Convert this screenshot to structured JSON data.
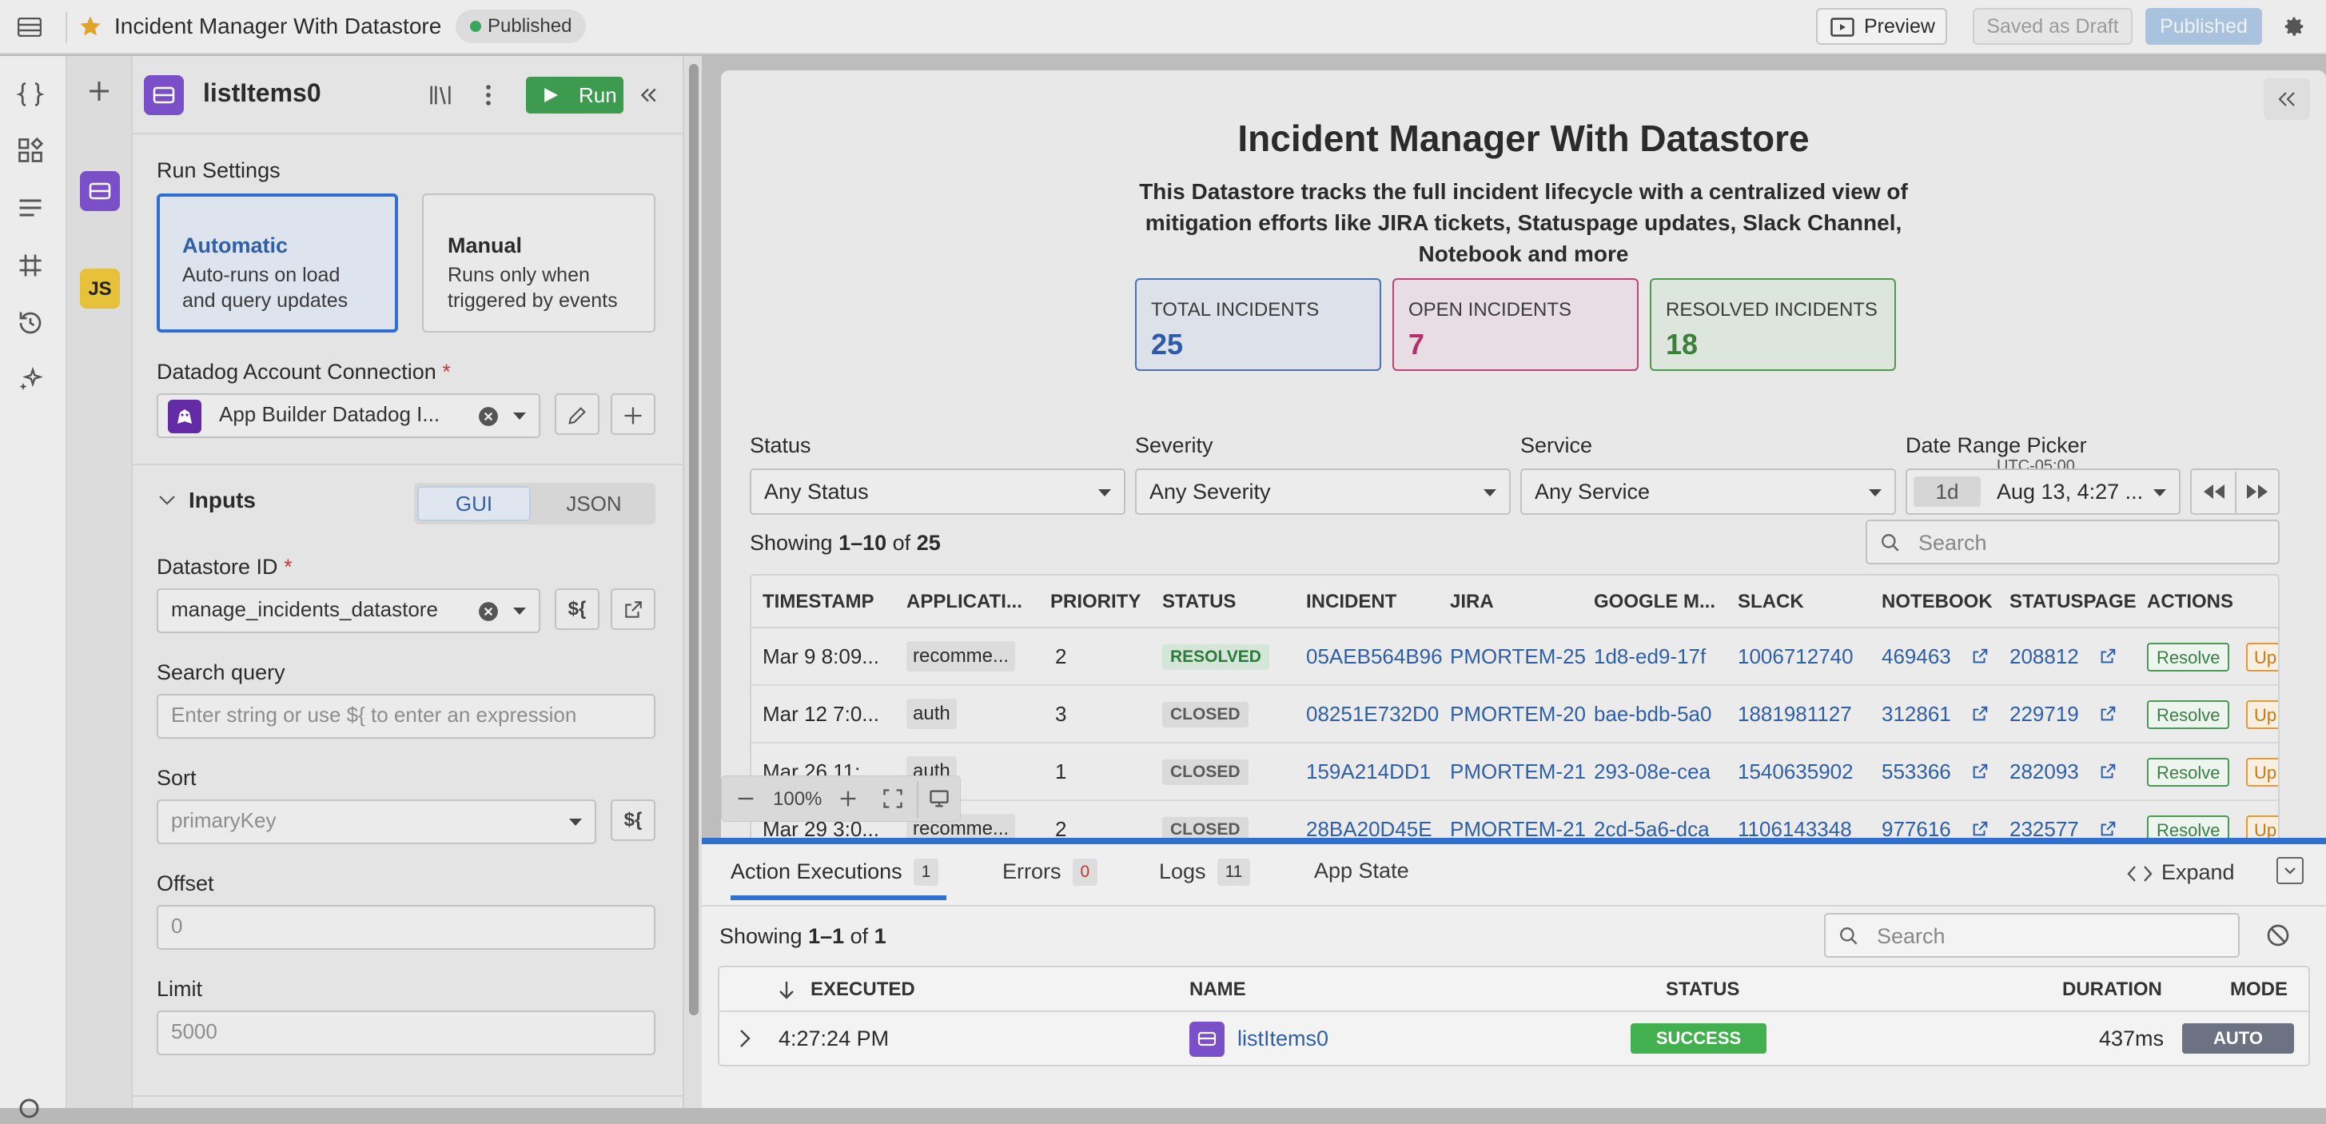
{
  "topbar": {
    "title": "Incident Manager With Datastore",
    "status_badge": "Published",
    "preview_label": "Preview",
    "draft_label": "Saved as Draft",
    "publish_label": "Published"
  },
  "rail": {
    "icons": [
      "layout-icon",
      "braces-icon",
      "components-icon",
      "list-icon",
      "grid-icon",
      "history-icon",
      "sparkle-icon",
      "search-icon"
    ]
  },
  "query_list": {
    "js_label": "JS"
  },
  "query_panel": {
    "name": "listItems0",
    "run_label": "Run",
    "run_settings_label": "Run Settings",
    "automatic": {
      "title": "Automatic",
      "desc1": "Auto-runs on load",
      "desc2": "and query updates"
    },
    "manual": {
      "title": "Manual",
      "desc1": "Runs only when",
      "desc2": "triggered by events"
    },
    "connection_label": "Datadog Account Connection",
    "connection_value": "App Builder Datadog I...",
    "inputs_label": "Inputs",
    "gui_tab": "GUI",
    "json_tab": "JSON",
    "datastore_label": "Datastore ID",
    "datastore_value": "manage_incidents_datastore",
    "expr_label": "${",
    "search_label": "Search query",
    "search_placeholder": "Enter string or use ${ to enter an expression",
    "sort_label": "Sort",
    "sort_value": "primaryKey",
    "offset_label": "Offset",
    "offset_value": "0",
    "limit_label": "Limit",
    "limit_value": "5000"
  },
  "app": {
    "title": "Incident Manager With Datastore",
    "desc_line1": "This Datastore tracks the full incident lifecycle with a centralized view of",
    "desc_line2": "mitigation efforts like JIRA tickets, Statuspage updates, Slack Channel,",
    "desc_line3": "Notebook and more",
    "stats": [
      {
        "label": "TOTAL INCIDENTS",
        "value": "25",
        "color": "#2d5aa8"
      },
      {
        "label": "OPEN INCIDENTS",
        "value": "7",
        "color": "#b3306a"
      },
      {
        "label": "RESOLVED INCIDENTS",
        "value": "18",
        "color": "#3e7f3c"
      }
    ],
    "filters": {
      "status_label": "Status",
      "status_value": "Any Status",
      "severity_label": "Severity",
      "severity_value": "Any Severity",
      "service_label": "Service",
      "service_value": "Any Service",
      "date_label": "Date Range Picker",
      "tz": "UTC-05:00",
      "range": "1d",
      "date_value": "Aug 13, 4:27 ..."
    },
    "showing_prefix": "Showing ",
    "showing_range": "1–10",
    "showing_of": " of ",
    "showing_total": "25",
    "search_placeholder": "Search",
    "columns": [
      "TIMESTAMP",
      "APPLICATI...",
      "PRIORITY",
      "STATUS",
      "INCIDENT",
      "JIRA",
      "GOOGLE M...",
      "SLACK",
      "NOTEBOOK",
      "STATUSPAGE",
      "ACTIONS"
    ],
    "rows": [
      {
        "ts": "Mar 9 8:09...",
        "app": "recomme...",
        "prio": "2",
        "status": "RESOLVED",
        "incident": "05AEB564B96",
        "jira": "PMORTEM-25",
        "gm": "1d8-ed9-17f",
        "slack": "1006712740",
        "notebook": "469463",
        "statuspage": "208812",
        "resolve": "Resolve",
        "update": "Up"
      },
      {
        "ts": "Mar 12 7:0...",
        "app": "auth",
        "prio": "3",
        "status": "CLOSED",
        "incident": "08251E732D0",
        "jira": "PMORTEM-20",
        "gm": "bae-bdb-5a0",
        "slack": "1881981127",
        "notebook": "312861",
        "statuspage": "229719",
        "resolve": "Resolve",
        "update": "Up"
      },
      {
        "ts": "Mar 26 11:...",
        "app": "auth",
        "prio": "1",
        "status": "CLOSED",
        "incident": "159A214DD1",
        "jira": "PMORTEM-21",
        "gm": "293-08e-cea",
        "slack": "1540635902",
        "notebook": "553366",
        "statuspage": "282093",
        "resolve": "Resolve",
        "update": "Up"
      },
      {
        "ts": "Mar 29 3:0...",
        "app": "recomme...",
        "prio": "2",
        "status": "CLOSED",
        "incident": "28BA20D45E",
        "jira": "PMORTEM-21",
        "gm": "2cd-5a6-dca",
        "slack": "1106143348",
        "notebook": "977616",
        "statuspage": "232577",
        "resolve": "Resolve",
        "update": "Up"
      }
    ]
  },
  "zoom": {
    "level": "100%"
  },
  "console": {
    "tabs": [
      {
        "label": "Action Executions",
        "count": "1"
      },
      {
        "label": "Errors",
        "count": "0"
      },
      {
        "label": "Logs",
        "count": "11"
      },
      {
        "label": "App State"
      }
    ],
    "expand_label": "Expand",
    "showing_prefix": "Showing ",
    "showing_range": "1–1",
    "showing_of": " of ",
    "showing_total": "1",
    "search_placeholder": "Search",
    "columns": {
      "executed": "EXECUTED",
      "name": "NAME",
      "status": "STATUS",
      "duration": "DURATION",
      "mode": "MODE"
    },
    "row": {
      "executed": "4:27:24 PM",
      "name": "listItems0",
      "status": "SUCCESS",
      "duration": "437ms",
      "mode": "AUTO"
    }
  }
}
